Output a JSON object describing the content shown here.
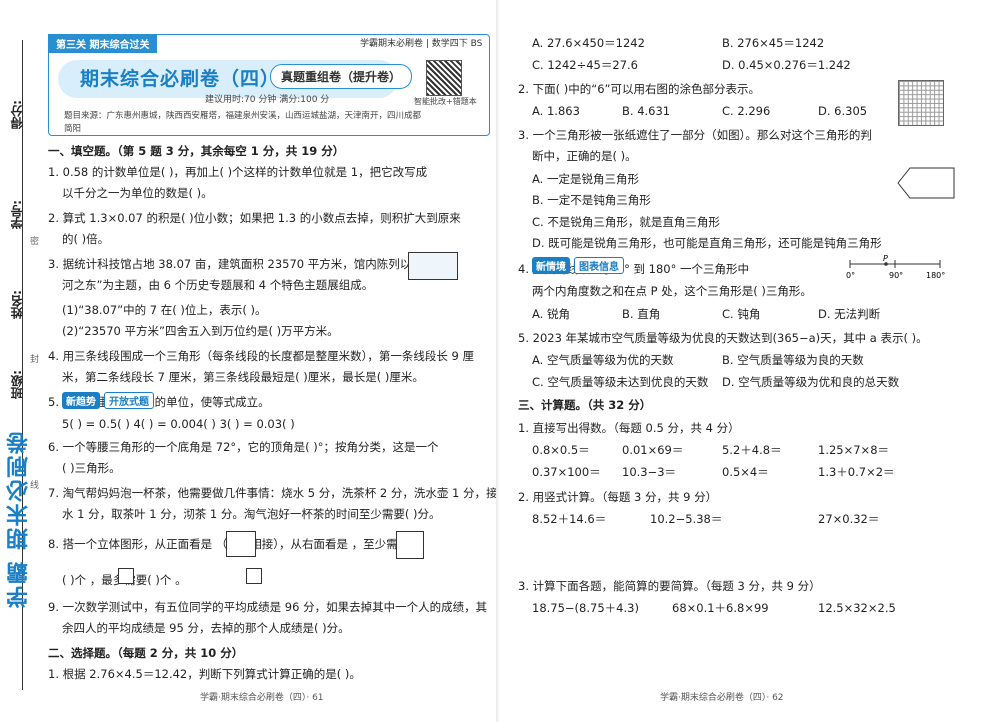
{
  "left": {
    "binding": {
      "score": "得分:",
      "student_id": "学号:",
      "name": "姓名:",
      "class": "班级:",
      "mi": "密",
      "feng": "封",
      "xian": "线",
      "brand": "学霸 期末必刷卷"
    },
    "header": {
      "tag": "第三关 期末综合过关",
      "series": "学霸期末必刷卷 | 数学四下 BS",
      "title": "期末综合必刷卷（四）",
      "subtitle": "真题重组卷（提升卷）",
      "meta": "建议用时:70 分钟      满分:100 分",
      "qr_caption": "智能批改+错题本",
      "source": "题目来源：广东惠州惠城，陕西西安雁塔，福建泉州安溪，山西运城盐湖，天津南开，四川成都简阳"
    },
    "lines": [
      "一、填空题。（第 5 题 3 分，其余每空 1 分，共 19 分）",
      "1. 0.58 的计数单位是(      )，再加上(      )个这样的计数单位就是 1，把它改写成",
      "以千分之一为单位的数是(      )。",
      "2. 算式 1.3×0.07 的积是(      )位小数；如果把 1.3 的小数点去掉，则积扩大到原来",
      "的(      )倍。",
      "3. 据统计科技馆占地 38.07 亩，建筑面积 23570 平方米，馆内陈列以“大",
      "河之东”为主题，由 6 个历史专题展和 4 个特色主题展组成。",
      "(1)“38.07”中的 7 在(      )位上，表示(      )。",
      "(2)“23570 平方米”四舍五入到万位约是(      )万平方米。",
      "4. 用三条线段围成一个三角形（每条线段的长度都是整厘米数），第一条线段长 9 厘",
      "米，第二条线段长 7 厘米，第三条线段最短是(      )厘米，最长是(      )厘米。",
      "5.                          在括号里填上合适的单位，使等式成立。",
      "5(      ) = 0.5(      )        4(      ) = 0.004(      )        3(      ) = 0.03(      )",
      "6. 一个等腰三角形的一个底角是 72°，它的顶角是(      )°；按角分类，这是一个",
      "(      )三角形。",
      "7. 淘气帮妈妈泡一杯茶，他需要做几件事情：烧水 5 分，洗茶杯 2 分，洗水壶 1 分，接",
      "水 1 分，取茶叶 1 分，沏茶 1 分。淘气泡好一杯茶的时间至少需要(      )分。",
      "8. 搭一个立体图形，从正面看是          （面面相接），从右面看是          ，至少需要",
      "(      )个       ，最多需要(      )个       。",
      "9. 一次数学测试中，有五位同学的平均成绩是 96 分，如果去掉其中一个人的成绩，其",
      "余四人的平均成绩是 95 分，去掉的那个人成绩是(      )分。",
      "二、选择题。（每题 2 分，共 10 分）",
      "1. 根据 2.76×4.5＝12.42，判断下列算式计算正确的是(      )。"
    ],
    "badge_new": "新趋势",
    "badge_open": "开放式题",
    "footer": "学霸·期末综合必刷卷（四）· 61"
  },
  "right": {
    "lines": [
      "A. 27.6×450＝1242",
      "B. 276×45＝1242",
      "C. 1242÷45＝27.6",
      "D. 0.45×0.276＝1.242",
      "2. 下面(      )中的“6”可以用右图的涂色部分表示。",
      "A. 1.863",
      "B. 4.631",
      "C. 2.296",
      "D. 6.305",
      "3. 一个三角形被一张纸遮住了一部分（如图）。那么对这个三角形的判",
      "断中，正确的是(      )。",
      "A. 一定是锐角三角形",
      "B. 一定不是钝角三角形",
      "C. 不是锐角三角形，就是直角三角形",
      "D. 既可能是锐角三角形，也可能是直角三角形，还可能是钝角三角形",
      "4.                        如图的线段表示 0° 到 180° 一个三角形中",
      "两个内角度数之和在点 P 处，这个三角形是(      )三角形。",
      "A. 锐角",
      "B. 直角",
      "C. 钝角",
      "D. 无法判断",
      "5. 2023 年某城市空气质量等级为优良的天数达到(365−a)天，其中 a 表示(      )。",
      "A. 空气质量等级为优的天数",
      "B. 空气质量等级为良的天数",
      "C. 空气质量等级未达到优良的天数",
      "D. 空气质量等级为优和良的总天数",
      "三、计算题。（共 32 分）",
      "1. 直接写出得数。（每题 0.5 分，共 4 分）",
      "0.8×0.5＝",
      "0.01×69＝",
      "5.2＋4.8＝",
      "1.25×7×8＝",
      "0.37×100＝",
      "10.3−3＝",
      "0.5×4＝",
      "1.3＋0.7×2＝",
      "2. 用竖式计算。（每题 3 分，共 9 分）",
      "8.52＋14.6＝",
      "10.2−5.38＝",
      "27×0.32＝",
      "3. 计算下面各题，能简算的要简算。（每题 3 分，共 9 分）",
      "18.75−(8.75＋4.3)",
      "68×0.1＋6.8×99",
      "12.5×32×2.5"
    ],
    "badge_new": "新情境",
    "badge_chart": "图表信息",
    "axis": {
      "zero": "0°",
      "p": "P",
      "ninety": "90°",
      "oneeighty": "180°"
    },
    "footer": "学霸·期末综合必刷卷（四）· 62"
  }
}
